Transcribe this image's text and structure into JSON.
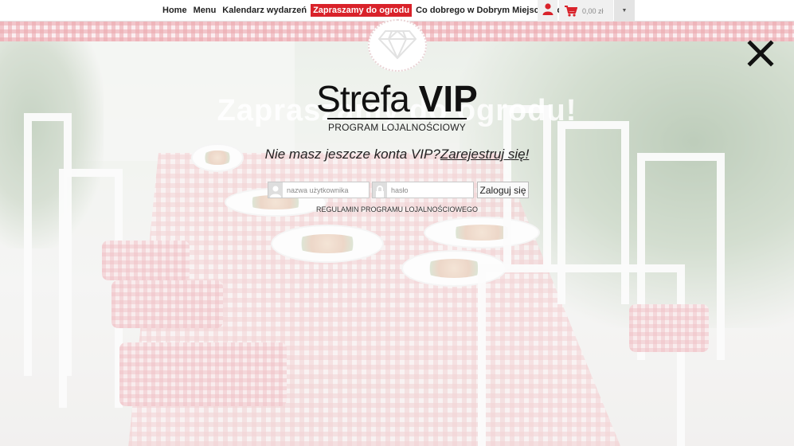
{
  "nav": {
    "items": [
      "Home",
      "Menu",
      "Kalendarz wydarzeń",
      "Zapraszamy do ogrodu",
      "Co dobrego w Dobrym Miejscu",
      "Kontakt"
    ],
    "active_index": 3
  },
  "cart": {
    "amount": "0,00 zł"
  },
  "background_heading": "Zapraszamy do ogrodu!",
  "vip": {
    "title_light": "Strefa ",
    "title_bold": "VIP",
    "subtitle": "PROGRAM LOJALNOŚCIOWY",
    "no_account_text": "Nie masz jeszcze konta VIP?",
    "register_link": "Zarejestruj się!",
    "username_placeholder": "nazwa użytkownika",
    "password_placeholder": "hasło",
    "login_button": "Zaloguj się",
    "terms_link": "REGULAMIN PROGRAMU LOJALNOŚCIOWEGO"
  },
  "colors": {
    "accent": "#d9222a",
    "text": "#111111"
  },
  "icons": [
    "user-icon",
    "cart-icon",
    "caret-down-icon",
    "diamond-icon",
    "close-icon",
    "lock-icon"
  ]
}
